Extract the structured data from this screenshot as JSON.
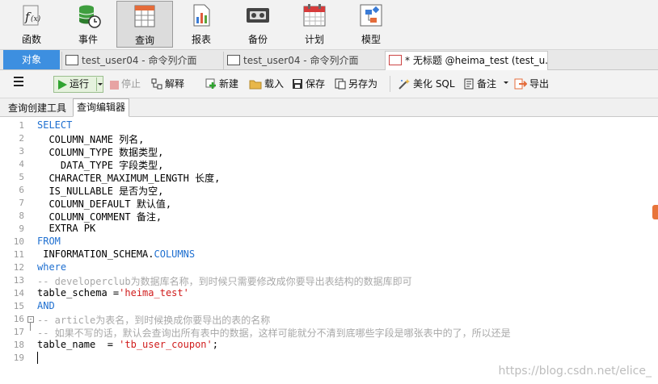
{
  "toolbar": {
    "items": [
      {
        "label": "函数",
        "icon": "function-icon"
      },
      {
        "label": "事件",
        "icon": "event-icon"
      },
      {
        "label": "查询",
        "icon": "query-icon",
        "active": true
      },
      {
        "label": "报表",
        "icon": "report-icon"
      },
      {
        "label": "备份",
        "icon": "backup-icon"
      },
      {
        "label": "计划",
        "icon": "schedule-icon"
      },
      {
        "label": "模型",
        "icon": "model-icon"
      }
    ]
  },
  "tabs": {
    "objects": "对象",
    "items": [
      {
        "label": "test_user04 - 命令列介面"
      },
      {
        "label": "test_user04 - 命令列介面"
      },
      {
        "label": "* 无标题 @heima_test (test_u..."
      }
    ]
  },
  "query_toolbar": {
    "run": "运行",
    "stop": "停止",
    "explain": "解释",
    "new": "新建",
    "load": "载入",
    "save": "保存",
    "save_as": "另存为",
    "beautify": "美化 SQL",
    "note": "备注",
    "export": "导出"
  },
  "subtabs": {
    "builder": "查询创建工具",
    "editor": "查询编辑器"
  },
  "editor": {
    "lines": [
      {
        "n": "1",
        "text": "SELECT",
        "kind": "kw"
      },
      {
        "n": "2",
        "text": "  COLUMN_NAME 列名,",
        "kind": "plain"
      },
      {
        "n": "3",
        "text": "  COLUMN_TYPE 数据类型,",
        "kind": "plain"
      },
      {
        "n": "4",
        "text": "    DATA_TYPE 字段类型,",
        "kind": "plain"
      },
      {
        "n": "5",
        "text": "  CHARACTER_MAXIMUM_LENGTH 长度,",
        "kind": "plain"
      },
      {
        "n": "6",
        "text": "  IS_NULLABLE 是否为空,",
        "kind": "plain"
      },
      {
        "n": "7",
        "text": "  COLUMN_DEFAULT 默认值,",
        "kind": "plain"
      },
      {
        "n": "8",
        "text": "  COLUMN_COMMENT 备注,",
        "kind": "plain"
      },
      {
        "n": "9",
        "text": "  EXTRA PK",
        "kind": "plain"
      },
      {
        "n": "10",
        "text": "FROM",
        "kind": "kw"
      },
      {
        "n": "11",
        "text": " INFORMATION_SCHEMA.",
        "kind": "plain",
        "tail": "COLUMNS",
        "tail_kind": "kw"
      },
      {
        "n": "12",
        "text": "where",
        "kind": "kw"
      },
      {
        "n": "13",
        "text": "-- developerclub为数据库名称，到时候只需要修改成你要导出表结构的数据库即可",
        "kind": "cm"
      },
      {
        "n": "14",
        "text": "table_schema =",
        "kind": "plain",
        "tail": "'heima_test'",
        "tail_kind": "str"
      },
      {
        "n": "15",
        "text": "AND",
        "kind": "kw"
      },
      {
        "n": "16",
        "text": "-- article为表名，到时候换成你要导出的表的名称",
        "kind": "cm"
      },
      {
        "n": "17",
        "text": "-- 如果不写的话，默认会查询出所有表中的数据，这样可能就分不清到底哪些字段是哪张表中的了，所以还是",
        "kind": "cm"
      },
      {
        "n": "18",
        "text": "table_name  = ",
        "kind": "plain",
        "tail": "'tb_user_coupon'",
        "tail_kind": "str",
        "tail2": ";"
      },
      {
        "n": "19",
        "text": "",
        "kind": "plain"
      }
    ]
  },
  "watermark": "https://blog.csdn.net/elice_"
}
